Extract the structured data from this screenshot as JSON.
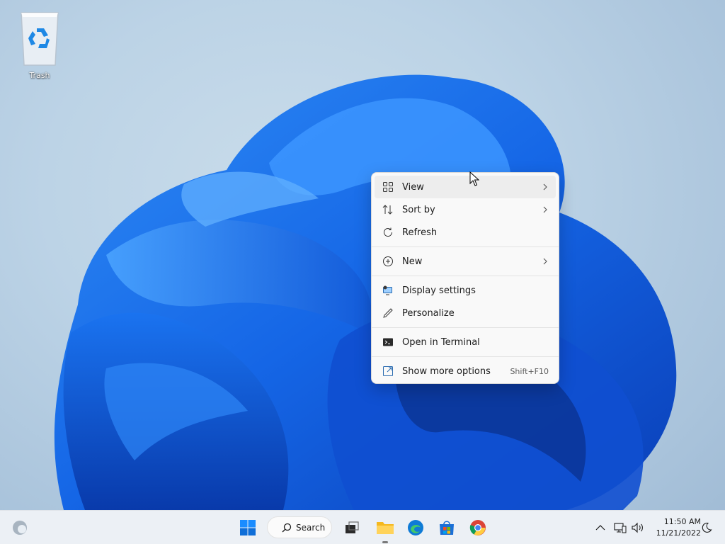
{
  "desktop": {
    "icons": [
      {
        "label": "Trash",
        "icon": "recycle-bin-icon"
      }
    ]
  },
  "context_menu": {
    "items": [
      {
        "label": "View",
        "icon": "view-grid-icon",
        "submenu": true
      },
      {
        "label": "Sort by",
        "icon": "sort-icon",
        "submenu": true
      },
      {
        "label": "Refresh",
        "icon": "refresh-icon",
        "submenu": false
      },
      {
        "label": "New",
        "icon": "plus-circle-icon",
        "submenu": true
      },
      {
        "label": "Display settings",
        "icon": "display-settings-icon",
        "submenu": false
      },
      {
        "label": "Personalize",
        "icon": "pen-icon",
        "submenu": false
      },
      {
        "label": "Open in Terminal",
        "icon": "terminal-icon",
        "submenu": false
      },
      {
        "label": "Show more options",
        "icon": "show-more-icon",
        "shortcut": "Shift+F10"
      }
    ]
  },
  "taskbar": {
    "search_label": "Search",
    "apps": [
      "start-icon",
      "search-icon",
      "task-view-icon",
      "file-explorer-icon",
      "edge-icon",
      "store-icon",
      "chrome-icon"
    ],
    "clock_time": "11:50 AM",
    "clock_date": "11/21/2022"
  },
  "colors": {
    "accent": "#0067c0",
    "menu_bg": "#f9f9f9",
    "taskbar_bg": "#ecf0f5"
  }
}
